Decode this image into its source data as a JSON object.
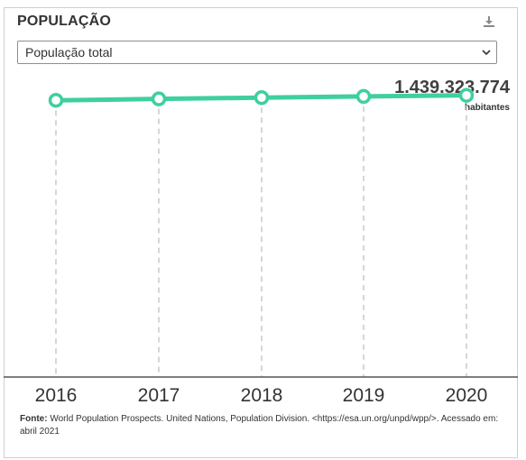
{
  "widget": {
    "title": "POPULAÇÃO",
    "download_icon": "download-icon",
    "select": {
      "selected": "População total",
      "icon": "chevron-down-icon"
    },
    "highlight": {
      "value": "1.439.323.774",
      "unit": "habitantes"
    },
    "source": {
      "label": "Fonte:",
      "text": "World Population Prospects. United Nations, Population Division. <https://esa.un.org/unpd/wpp/>. Acessado em: abril 2021"
    }
  },
  "colors": {
    "line": "#3fcfa0",
    "grid": "#c8c8c8",
    "axis": "#555555"
  },
  "chart_data": {
    "type": "line",
    "categories": [
      "2016",
      "2017",
      "2018",
      "2019",
      "2020"
    ],
    "series": [
      {
        "values": [
          1414049351,
          1421021791,
          1427647786,
          1433783686,
          1439323774
        ]
      }
    ],
    "ylim": [
      0,
      1650000000
    ],
    "grid": false
  }
}
